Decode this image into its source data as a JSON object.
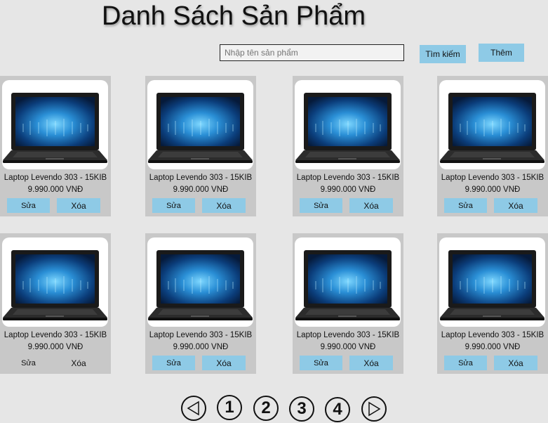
{
  "page": {
    "title": "Danh Sách Sản Phẩm"
  },
  "search": {
    "placeholder": "Nhập tên sản phẩm",
    "button_label": "Tìm kiếm"
  },
  "add_button_label": "Thêm",
  "products": [
    {
      "name": "Laptop Levendo 303 - 15KIB",
      "price": "9.990.000 VNĐ",
      "edit_label": "Sửa",
      "delete_label": "Xóa"
    },
    {
      "name": "Laptop Levendo 303 - 15KIB",
      "price": "9.990.000 VNĐ",
      "edit_label": "Sửa",
      "delete_label": "Xóa"
    },
    {
      "name": "Laptop Levendo 303 - 15KIB",
      "price": "9.990.000 VNĐ",
      "edit_label": "Sửa",
      "delete_label": "Xóa"
    },
    {
      "name": "Laptop Levendo 303 - 15KIB",
      "price": "9.990.000 VNĐ",
      "edit_label": "Sửa",
      "delete_label": "Xóa"
    },
    {
      "name": "Laptop Levendo 303 - 15KIB",
      "price": "9.990.000 VNĐ",
      "edit_label": "Sửa",
      "delete_label": "Xóa"
    },
    {
      "name": "Laptop Levendo 303 - 15KIB",
      "price": "9.990.000 VNĐ",
      "edit_label": "Sửa",
      "delete_label": "Xóa"
    },
    {
      "name": "Laptop Levendo 303 - 15KIB",
      "price": "9.990.000 VNĐ",
      "edit_label": "Sửa",
      "delete_label": "Xóa"
    },
    {
      "name": "Laptop Levendo 303 - 15KIB",
      "price": "9.990.000 VNĐ",
      "edit_label": "Sửa",
      "delete_label": "Xóa"
    }
  ],
  "pagination": {
    "prev_icon": "triangle-left-icon",
    "pages": [
      "1",
      "2",
      "3",
      "4"
    ],
    "next_icon": "triangle-right-icon"
  },
  "colors": {
    "background": "#e6e6e6",
    "card": "#c8c8c8",
    "button": "#8ecae6"
  }
}
